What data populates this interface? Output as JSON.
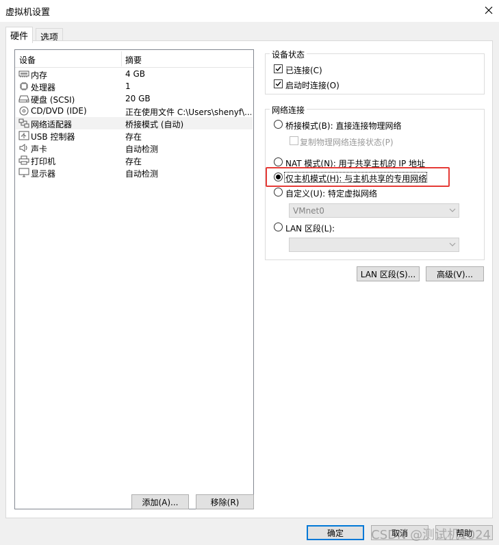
{
  "window": {
    "title": "虚拟机设置",
    "close_icon": "close-icon"
  },
  "tabs": [
    {
      "label": "硬件"
    },
    {
      "label": "选项"
    }
  ],
  "device_list": {
    "headers": {
      "device": "设备",
      "summary": "摘要"
    },
    "rows": [
      {
        "icon": "memory-icon",
        "name": "内存",
        "summary": "4 GB"
      },
      {
        "icon": "processor-icon",
        "name": "处理器",
        "summary": "1"
      },
      {
        "icon": "harddisk-icon",
        "name": "硬盘 (SCSI)",
        "summary": "20 GB"
      },
      {
        "icon": "cd-dvd-icon",
        "name": "CD/DVD (IDE)",
        "summary": "正在使用文件 C:\\Users\\shenyf\\..."
      },
      {
        "icon": "network-adapter-icon",
        "name": "网络适配器",
        "summary": "桥接模式 (自动)"
      },
      {
        "icon": "usb-icon",
        "name": "USB 控制器",
        "summary": "存在"
      },
      {
        "icon": "sound-icon",
        "name": "声卡",
        "summary": "自动检测"
      },
      {
        "icon": "printer-icon",
        "name": "打印机",
        "summary": "存在"
      },
      {
        "icon": "display-icon",
        "name": "显示器",
        "summary": "自动检测"
      }
    ],
    "selected_index": 4
  },
  "list_buttons": {
    "add": "添加(A)...",
    "remove": "移除(R)"
  },
  "device_status": {
    "title": "设备状态",
    "connected": {
      "label": "已连接(C)",
      "checked": true
    },
    "connect_at_power_on": {
      "label": "启动时连接(O)",
      "checked": true
    }
  },
  "network": {
    "title": "网络连接",
    "bridged": "桥接模式(B): 直接连接物理网络",
    "replicate": "复制物理网络连接状态(P)",
    "nat": "NAT 模式(N): 用于共享主机的 IP 地址",
    "host_only": "仅主机模式(H): 与主机共享的专用网络",
    "custom": "自定义(U): 特定虚拟网络",
    "custom_value": "VMnet0",
    "lan": "LAN 区段(L):",
    "lan_value": "",
    "selected": "host_only"
  },
  "network_buttons": {
    "lan_segments": "LAN 区段(S)...",
    "advanced": "高级(V)..."
  },
  "footer": {
    "ok": "确定",
    "cancel": "取消",
    "help": "帮助"
  },
  "watermark": "CSDN @测试机1024"
}
